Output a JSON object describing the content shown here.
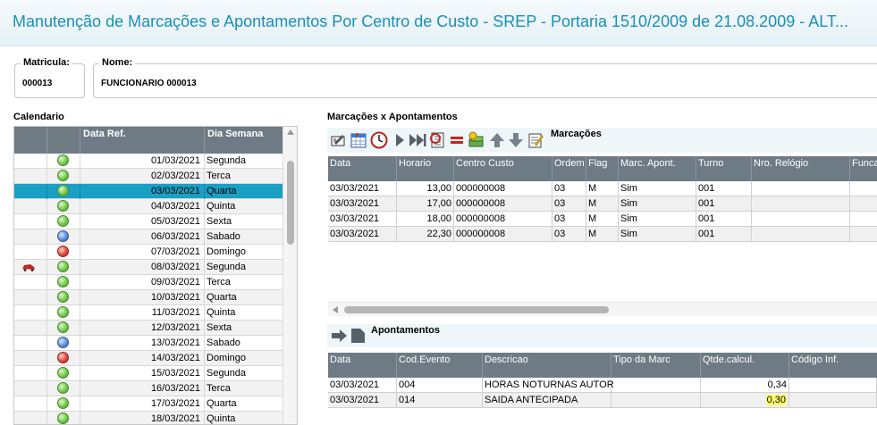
{
  "window": {
    "title": "Manutenção de Marcações e Apontamentos Por Centro de Custo - SREP - Portaria 1510/2009 de 21.08.2009 - ALT..."
  },
  "header": {
    "matricula_label": "Matricula:",
    "matricula_value": "000013",
    "nome_label": "Nome:",
    "nome_value": "FUNCIONARIO 000013"
  },
  "calendar": {
    "label": "Calendario",
    "columns": [
      "",
      "",
      "Data Ref.",
      "Dia Semana"
    ],
    "rows": [
      {
        "status": "green",
        "date": "01/03/2021",
        "day": "Segunda",
        "flag": ""
      },
      {
        "status": "green",
        "date": "02/03/2021",
        "day": "Terca",
        "flag": ""
      },
      {
        "status": "green",
        "date": "03/03/2021",
        "day": "Quarta",
        "flag": "",
        "selected": true
      },
      {
        "status": "green",
        "date": "04/03/2021",
        "day": "Quinta",
        "flag": ""
      },
      {
        "status": "green",
        "date": "05/03/2021",
        "day": "Sexta",
        "flag": ""
      },
      {
        "status": "blue",
        "date": "06/03/2021",
        "day": "Sabado",
        "flag": ""
      },
      {
        "status": "red",
        "date": "07/03/2021",
        "day": "Domingo",
        "flag": ""
      },
      {
        "status": "green",
        "date": "08/03/2021",
        "day": "Segunda",
        "flag": "car-icon"
      },
      {
        "status": "green",
        "date": "09/03/2021",
        "day": "Terca",
        "flag": ""
      },
      {
        "status": "green",
        "date": "10/03/2021",
        "day": "Quarta",
        "flag": ""
      },
      {
        "status": "green",
        "date": "11/03/2021",
        "day": "Quinta",
        "flag": ""
      },
      {
        "status": "green",
        "date": "12/03/2021",
        "day": "Sexta",
        "flag": ""
      },
      {
        "status": "blue",
        "date": "13/03/2021",
        "day": "Sabado",
        "flag": ""
      },
      {
        "status": "red",
        "date": "14/03/2021",
        "day": "Domingo",
        "flag": ""
      },
      {
        "status": "green",
        "date": "15/03/2021",
        "day": "Segunda",
        "flag": ""
      },
      {
        "status": "green",
        "date": "16/03/2021",
        "day": "Terca",
        "flag": ""
      },
      {
        "status": "green",
        "date": "17/03/2021",
        "day": "Quarta",
        "flag": ""
      },
      {
        "status": "green",
        "date": "18/03/2021",
        "day": "Quinta",
        "flag": ""
      }
    ]
  },
  "marcacoes": {
    "section_label": "Marcações x Apontamentos",
    "toolbar_label": "Marcações",
    "toolbar_icons": [
      "edit-icon",
      "calendar-icon",
      "clock-icon",
      "play-icon",
      "fast-forward-icon",
      "refresh-icon",
      "equals-icon",
      "money-icon",
      "arrow-up-icon",
      "arrow-down-icon",
      "notes-icon"
    ],
    "columns": [
      "Data",
      "Horario",
      "Centro Custo",
      "Ordem",
      "Flag",
      "Marc. Apont.",
      "Turno",
      "Nro. Relógio",
      "Funcao"
    ],
    "rows": [
      {
        "data": "03/03/2021",
        "horario": "13,00",
        "centro": "000000008",
        "ordem": "03",
        "flag": "M",
        "marc": "Sim",
        "turno": "001"
      },
      {
        "data": "03/03/2021",
        "horario": "17,00",
        "centro": "000000008",
        "ordem": "03",
        "flag": "M",
        "marc": "Sim",
        "turno": "001"
      },
      {
        "data": "03/03/2021",
        "horario": "18,00",
        "centro": "000000008",
        "ordem": "03",
        "flag": "M",
        "marc": "Sim",
        "turno": "001"
      },
      {
        "data": "03/03/2021",
        "horario": "22,30",
        "centro": "000000008",
        "ordem": "03",
        "flag": "M",
        "marc": "Sim",
        "turno": "001"
      }
    ]
  },
  "apontamentos": {
    "toolbar_label": "Apontamentos",
    "toolbar_icons": [
      "arrow-right-icon",
      "document-icon"
    ],
    "columns": [
      "Data",
      "Cod.Evento",
      "Descricao",
      "Tipo da Marc",
      "Qtde.calcul.",
      "Código Inf."
    ],
    "rows": [
      {
        "data": "03/03/2021",
        "cod": "004",
        "desc": "HORAS NOTURNAS AUTOR",
        "tipo": "",
        "qtde": "0,34",
        "codinf": "",
        "highlight": false
      },
      {
        "data": "03/03/2021",
        "cod": "014",
        "desc": "SAIDA ANTECIPADA",
        "tipo": "",
        "qtde": "0,30",
        "codinf": "",
        "highlight": true
      }
    ]
  },
  "colors": {
    "title": "#1b8fb8",
    "grid_header": "#6e7b84",
    "selected_row": "#1aa0c2",
    "highlight": "#ffff66"
  }
}
